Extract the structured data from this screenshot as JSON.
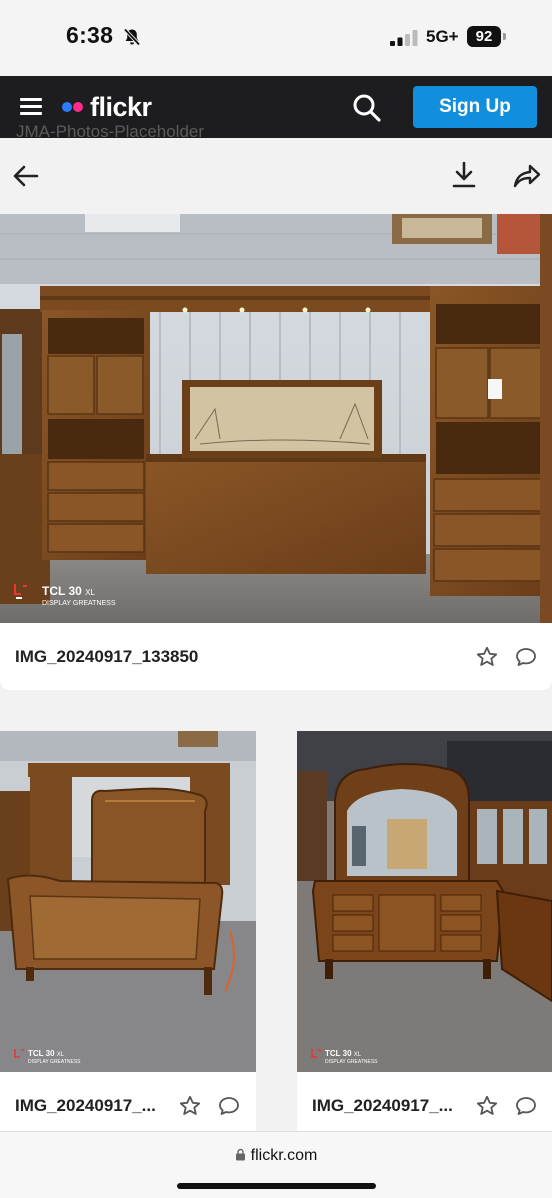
{
  "status_bar": {
    "time": "6:38",
    "network": "5G+",
    "battery": "92"
  },
  "nav": {
    "logo_text": "flickr",
    "signup_label": "Sign Up",
    "underlay_text": "JMA-Photos-Placeholder"
  },
  "photos": [
    {
      "title": "IMG_20240917_133850",
      "watermark_brand": "TCL 30",
      "watermark_model": "XL",
      "watermark_tagline": "DISPLAY GREATNESS",
      "subject": "bedroom-wall-unit"
    },
    {
      "title": "IMG_20240917_...",
      "watermark_brand": "TCL 30",
      "watermark_model": "XL",
      "watermark_tagline": "DISPLAY GREATNESS",
      "subject": "sleigh-bed"
    },
    {
      "title": "IMG_20240917_...",
      "watermark_brand": "TCL 30",
      "watermark_model": "XL",
      "watermark_tagline": "DISPLAY GREATNESS",
      "subject": "dresser-with-mirror"
    }
  ],
  "browser": {
    "url": "flickr.com"
  },
  "colors": {
    "nav_bg": "#1d1d1f",
    "signup_bg": "#128fdc",
    "logo_blue": "#2f7bff",
    "logo_pink": "#ff2c8a"
  }
}
